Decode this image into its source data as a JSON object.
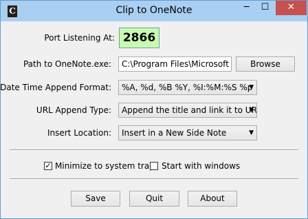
{
  "window": {
    "title": "Clip to OneNote",
    "app_icon_glyph": "C",
    "minimize_glyph": "─",
    "maximize_glyph": "☐",
    "close_glyph": "✕"
  },
  "port": {
    "label": "Port Listening At:",
    "value": "2866"
  },
  "path": {
    "label": "Path to OneNote.exe:",
    "value": "C:\\Program Files\\Microsoft Office",
    "browse_label": "Browse"
  },
  "datetime": {
    "label": "Date Time Append Format:",
    "value": "%A, %d, %B %Y, %I:%M:%S %p"
  },
  "url_append": {
    "label": "URL Append Type:",
    "value": "Append the title and link it to URL"
  },
  "insert_location": {
    "label": "Insert Location:",
    "value": "Insert in a New Side Note"
  },
  "options": {
    "minimize_tray_label": "Minimize to system tray",
    "minimize_tray_checked": true,
    "start_windows_label": "Start with windows",
    "start_windows_checked": false
  },
  "buttons": {
    "save": "Save",
    "quit": "Quit",
    "about": "About"
  },
  "icons": {
    "dropdown": "▼",
    "checkmark": "✓"
  },
  "colors": {
    "titlebar": "#a9cff2",
    "close_button": "#c75050",
    "port_highlight": "#c9fab0"
  }
}
